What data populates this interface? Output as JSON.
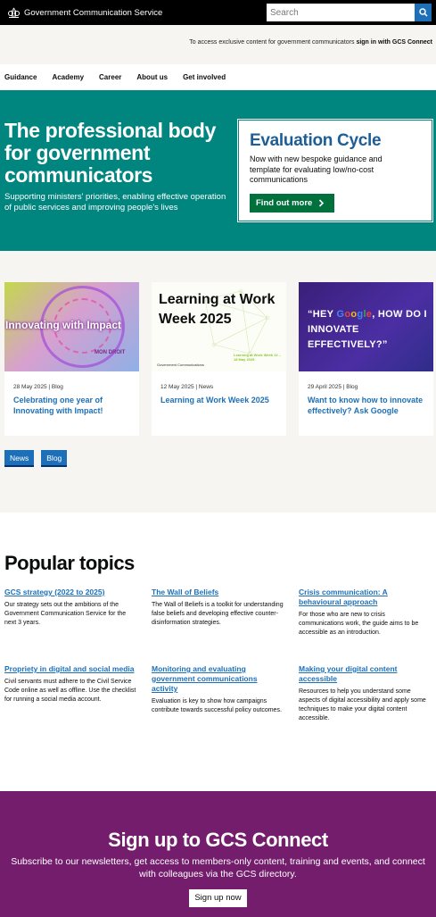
{
  "header": {
    "brand": "Government Communication Service",
    "search_placeholder": "Search"
  },
  "access": {
    "text": "To access exclusive content for government communicators ",
    "link": "sign in with GCS Connect"
  },
  "nav": [
    "Guidance",
    "Academy",
    "Career",
    "About us",
    "Get involved"
  ],
  "hero": {
    "title": "The professional body for government communicators",
    "subtitle": "Supporting ministers' priorities, enabling effective operation of public services and improving people's lives",
    "promo": {
      "title": "Evaluation Cycle",
      "text": "Now with new bespoke guidance and template for evaluating low/no-cost communications",
      "button": "Find out more"
    }
  },
  "cards": [
    {
      "image_text": "Innovating with Impact",
      "image_subtext": "MON DROIT",
      "meta": "28 May 2025 | Blog",
      "title": "Celebrating one year of Innovating with Impact!"
    },
    {
      "image_text": "Learning at Work Week 2025",
      "image_logo": "Government Communications",
      "image_tag": "Learning at Work Week 12 – 18 May 2025",
      "meta": "12 May 2025 | News",
      "title": "Learning at Work Week 2025"
    },
    {
      "image_text_pre": "“HEY ",
      "image_text_post": ", HOW DO I INNOVATE EFFECTIVELY?”",
      "meta": "29 April 2025 | Blog",
      "title": "Want to know how to innovate effectively? Ask Google"
    }
  ],
  "tags": [
    "News",
    "Blog"
  ],
  "popular": {
    "heading": "Popular topics",
    "topics": [
      {
        "title": "GCS strategy (2022 to 2025)",
        "text": "Our strategy sets out the ambitions of the Government Communication Service for the next 3 years."
      },
      {
        "title": "The Wall of Beliefs",
        "text": "The Wall of Beliefs is a toolkit for understanding false beliefs and developing effective counter-disinformation strategies."
      },
      {
        "title": "Crisis communication: A behavioural approach",
        "text": "For those who are new to crisis communications work, the guide aims to be accessible as an introduction."
      },
      {
        "title": "Propriety in digital and social media",
        "text": "Civil servants must adhere to the Civil Service Code online as well as offline. Use the checklist for running a social media account."
      },
      {
        "title": "Monitoring and evaluating government communications activity",
        "text": "Evaluation is key to show how campaigns contribute towards successful policy outcomes."
      },
      {
        "title": "Making your digital content accessible",
        "text": "Resources to help you understand some aspects of digital accessibility and apply some techniques to make your digital content accessible."
      }
    ]
  },
  "signup": {
    "title": "Sign up to GCS Connect",
    "text": "Subscribe to our newsletters, get access to members-only content, training and events, and connect with colleagues via the GCS directory.",
    "button": "Sign up now"
  },
  "colors": {
    "hero_bg": "#00857f",
    "link": "#1d70b8",
    "button_green": "#00703c",
    "signup_bg": "#741d6d"
  }
}
